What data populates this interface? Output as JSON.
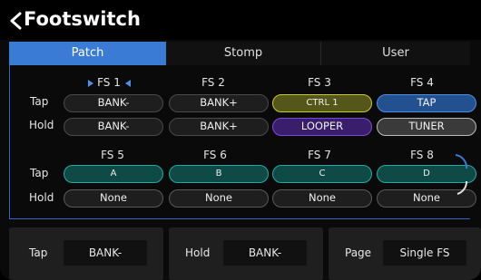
{
  "header": {
    "title": "Footswitch",
    "back_icon": "chevron-left-icon"
  },
  "tabs": [
    {
      "label": "Patch",
      "active": true
    },
    {
      "label": "Stomp",
      "active": false
    },
    {
      "label": "User",
      "active": false
    }
  ],
  "grid_labels": {
    "tap": "Tap",
    "hold": "Hold"
  },
  "switches": [
    {
      "name": "FS 1",
      "selected": true,
      "tap": {
        "label": "BANK-",
        "color": "#1e1e1e",
        "border": "#4a4a4a"
      },
      "hold": {
        "label": "BANK-",
        "color": "#1e1e1e",
        "border": "#4a4a4a"
      }
    },
    {
      "name": "FS 2",
      "selected": false,
      "tap": {
        "label": "BANK+",
        "color": "#1e1e1e",
        "border": "#4a4a4a"
      },
      "hold": {
        "label": "BANK+",
        "color": "#1e1e1e",
        "border": "#4a4a4a"
      }
    },
    {
      "name": "FS 3",
      "selected": false,
      "tap": {
        "label": "CTRL 1",
        "color": "#55561a",
        "border": "#c9c931"
      },
      "hold": {
        "label": "LOOPER",
        "color": "#3a1e6b",
        "border": "#7b4be0"
      }
    },
    {
      "name": "FS 4",
      "selected": false,
      "tap": {
        "label": "TAP",
        "color": "#23508f",
        "border": "#4d8fe8"
      },
      "hold": {
        "label": "TUNER",
        "color": "#3a3a3a",
        "border": "#bdbdbd"
      }
    },
    {
      "name": "FS 5",
      "selected": false,
      "tap": {
        "label": "A",
        "color": "#0f4a47",
        "border": "#22a9a0"
      },
      "hold": {
        "label": "None",
        "color": "#1e1e1e",
        "border": "#4a4a4a"
      }
    },
    {
      "name": "FS 6",
      "selected": false,
      "tap": {
        "label": "B",
        "color": "#0f4a47",
        "border": "#22a9a0"
      },
      "hold": {
        "label": "None",
        "color": "#1e1e1e",
        "border": "#4a4a4a"
      }
    },
    {
      "name": "FS 7",
      "selected": false,
      "tap": {
        "label": "C",
        "color": "#0f4a47",
        "border": "#22a9a0"
      },
      "hold": {
        "label": "None",
        "color": "#1e1e1e",
        "border": "#4a4a4a"
      }
    },
    {
      "name": "FS 8",
      "selected": false,
      "tap": {
        "label": "D",
        "color": "#0f4a47",
        "border": "#22a9a0"
      },
      "hold": {
        "label": "None",
        "color": "#1e1e1e",
        "border": "#4a4a4a"
      }
    }
  ],
  "bottom": {
    "tap": {
      "label": "Tap",
      "value": "BANK-"
    },
    "hold": {
      "label": "Hold",
      "value": "BANK-"
    },
    "page": {
      "label": "Page",
      "value": "Single FS"
    }
  },
  "colors": {
    "accent": "#3a7bd5",
    "selection_marker": "#4d8fe8"
  }
}
